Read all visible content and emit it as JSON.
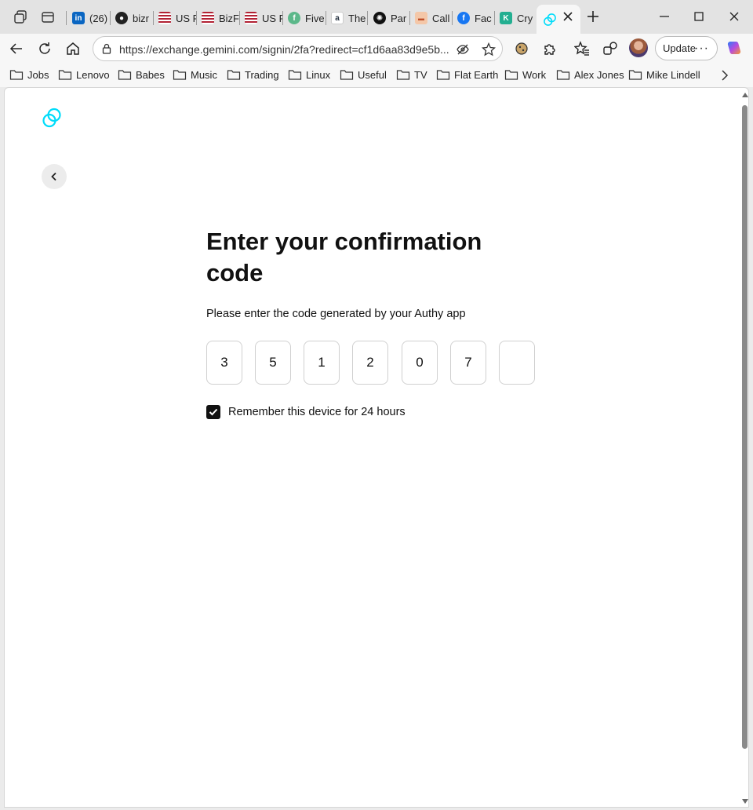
{
  "browser": {
    "tabs": [
      {
        "title": "(26)",
        "icon": "linkedin-icon",
        "color": "#0a66c2"
      },
      {
        "title": "bizr",
        "icon": "github-icon",
        "color": "#222222"
      },
      {
        "title": "US F",
        "icon": "flag-icon",
        "color": "#b22234"
      },
      {
        "title": "BizF",
        "icon": "flag-icon",
        "color": "#b22234"
      },
      {
        "title": "US F",
        "icon": "flag-icon",
        "color": "#b22234"
      },
      {
        "title": "Five",
        "icon": "fiverr-icon",
        "color": "#5cb88a"
      },
      {
        "title": "The",
        "icon": "amazon-icon",
        "color": "#232f3e"
      },
      {
        "title": "Par",
        "icon": "openai-icon",
        "color": "#111111"
      },
      {
        "title": "Call",
        "icon": "call-icon",
        "color": "#f0a070"
      },
      {
        "title": "Fac",
        "icon": "facebook-icon",
        "color": "#1877f2"
      },
      {
        "title": "Cry",
        "icon": "kucoin-icon",
        "color": "#23af91"
      }
    ],
    "active_tab_icon_color": "#00dcfa",
    "url": "https://exchange.gemini.com/signin/2fa?redirect=cf1d6aa83d9e5b...",
    "update_label": "Update",
    "update_menu": "···",
    "bookmarks": [
      "Jobs",
      "Lenovo",
      "Babes",
      "Music",
      "Trading",
      "Linux",
      "Useful",
      "TV",
      "Flat Earth",
      "Work",
      "Alex Jones",
      "Mike Lindell"
    ]
  },
  "page": {
    "brand_color": "#00dcfa",
    "heading": "Enter your confirmation code",
    "subtext": "Please enter the code generated by your Authy app",
    "code_digits": [
      "3",
      "5",
      "1",
      "2",
      "0",
      "7",
      ""
    ],
    "remember_label": "Remember this device for 24 hours",
    "remember_checked": true
  }
}
